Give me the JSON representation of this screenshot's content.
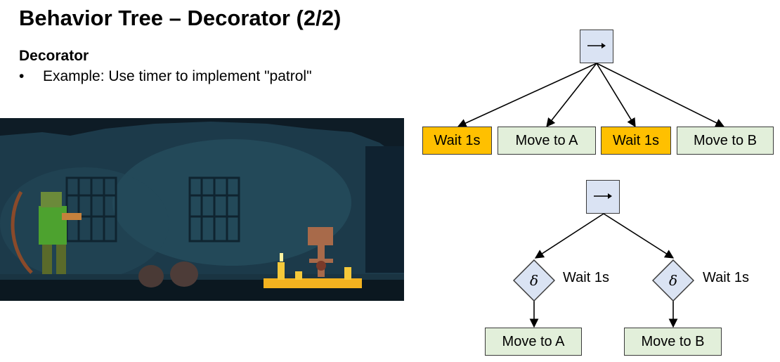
{
  "slide": {
    "title": "Behavior Tree – Decorator (2/2)",
    "section_heading": "Decorator",
    "bullet": "Example: Use timer to implement \"patrol\""
  },
  "tree_top": {
    "root_icon": "sequence-arrow-icon",
    "children": [
      {
        "label": "Wait 1s",
        "kind": "wait"
      },
      {
        "label": "Move to A",
        "kind": "move"
      },
      {
        "label": "Wait 1s",
        "kind": "wait"
      },
      {
        "label": "Move to B",
        "kind": "move"
      }
    ]
  },
  "tree_bottom": {
    "root_icon": "sequence-arrow-icon",
    "decorators": [
      {
        "symbol": "δ",
        "label": "Wait 1s",
        "child": "Move to A"
      },
      {
        "symbol": "δ",
        "label": "Wait 1s",
        "child": "Move to B"
      }
    ]
  },
  "colors": {
    "wait": "#ffc000",
    "move": "#e2efda",
    "sequence": "#dae3f3",
    "decorator": "#dae3f3"
  },
  "image": {
    "name": "game-screenshot-patrol"
  }
}
